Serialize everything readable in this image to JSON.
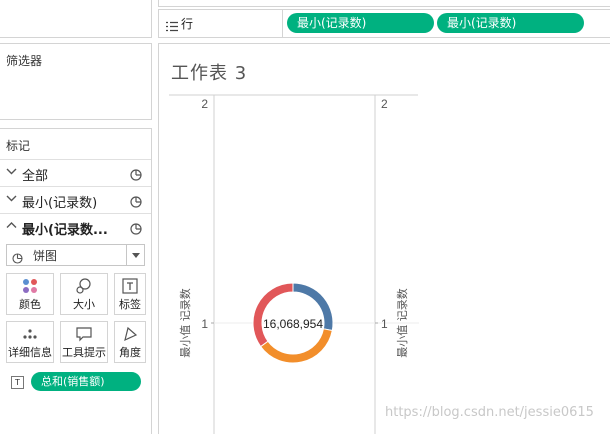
{
  "shelf": {
    "rows_label": "行",
    "pills": [
      "最小(记录数)",
      "最小(记录数)"
    ]
  },
  "filters": {
    "title": "筛选器"
  },
  "marks": {
    "title": "标记",
    "rows": [
      {
        "label": "全部",
        "expanded": false
      },
      {
        "label": "最小(记录数)",
        "expanded": false
      },
      {
        "label": "最小(记录数...",
        "expanded": true
      }
    ],
    "mark_type": "饼图",
    "buttons": [
      "颜色",
      "大小",
      "标签",
      "详细信息",
      "工具提示",
      "角度"
    ],
    "label_pill_icon": "T",
    "label_pill": "总和(销售额)"
  },
  "sheet": {
    "title": "工作表 3",
    "axis_left_title": "最小值 记录数",
    "axis_right_title": "最小值 记录数",
    "axis_ticks": [
      "2",
      "1"
    ],
    "donut_label": "16,068,954",
    "donut_colors": [
      "#4e79a7",
      "#f28e2b",
      "#e15759"
    ],
    "donut_slices": [
      0.28,
      0.37,
      0.35
    ]
  },
  "watermark": "https://blog.csdn.net/jessie0615"
}
